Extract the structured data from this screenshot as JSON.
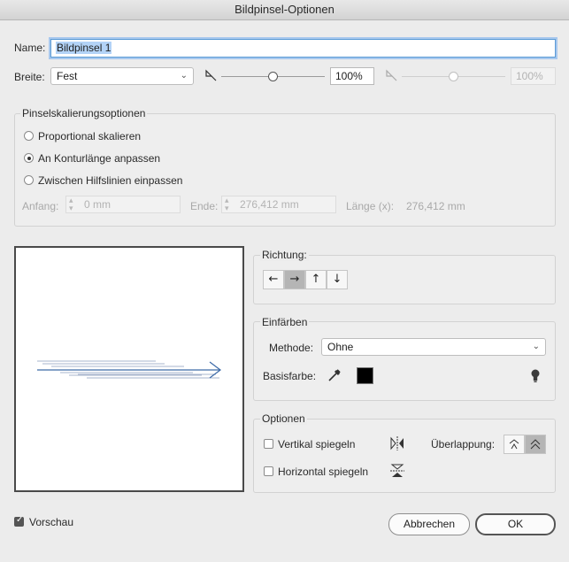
{
  "window": {
    "title": "Bildpinsel-Optionen"
  },
  "name": {
    "label": "Name:",
    "value": "Bildpinsel 1"
  },
  "breite": {
    "label": "Breite:",
    "select_value": "Fest",
    "percent_value": "100%",
    "percent_value_disabled": "100%",
    "slider_level": 0.5,
    "slider_level_disabled": 0.5
  },
  "scaling": {
    "title": "Pinselskalierungsoptionen",
    "options": [
      {
        "label": "Proportional skalieren",
        "selected": false
      },
      {
        "label": "An Konturlänge anpassen",
        "selected": true
      },
      {
        "label": "Zwischen Hilfslinien einpassen",
        "selected": false
      }
    ],
    "anfang_label": "Anfang:",
    "anfang_value": "0 mm",
    "ende_label": "Ende:",
    "ende_value": "276,412 mm",
    "laenge_label": "Länge (x):",
    "laenge_value": "276,412 mm"
  },
  "direction": {
    "title": "Richtung:",
    "buttons": [
      {
        "icon": "arrow-left-icon",
        "glyph": "←",
        "active": false
      },
      {
        "icon": "arrow-right-icon",
        "glyph": "→",
        "active": true
      },
      {
        "icon": "arrow-up-icon",
        "glyph": "↑",
        "active": false
      },
      {
        "icon": "arrow-down-icon",
        "glyph": "↓",
        "active": false
      }
    ]
  },
  "colorize": {
    "title": "Einfärben",
    "method_label": "Methode:",
    "method_value": "Ohne",
    "base_color_label": "Basisfarbe:",
    "base_color": "#000000"
  },
  "options": {
    "title": "Optionen",
    "flip_vertical_label": "Vertikal spiegeln",
    "flip_vertical_checked": false,
    "flip_horizontal_label": "Horizontal spiegeln",
    "flip_horizontal_checked": false,
    "overlap_label": "Überlappung:"
  },
  "footer": {
    "preview_label": "Vorschau",
    "preview_checked": true,
    "cancel_label": "Abbrechen",
    "ok_label": "OK"
  },
  "colors": {
    "focus_ring": "#5b9bd5",
    "selection": "#b3d3f7",
    "preview_arrow": "#3c6aa8"
  }
}
